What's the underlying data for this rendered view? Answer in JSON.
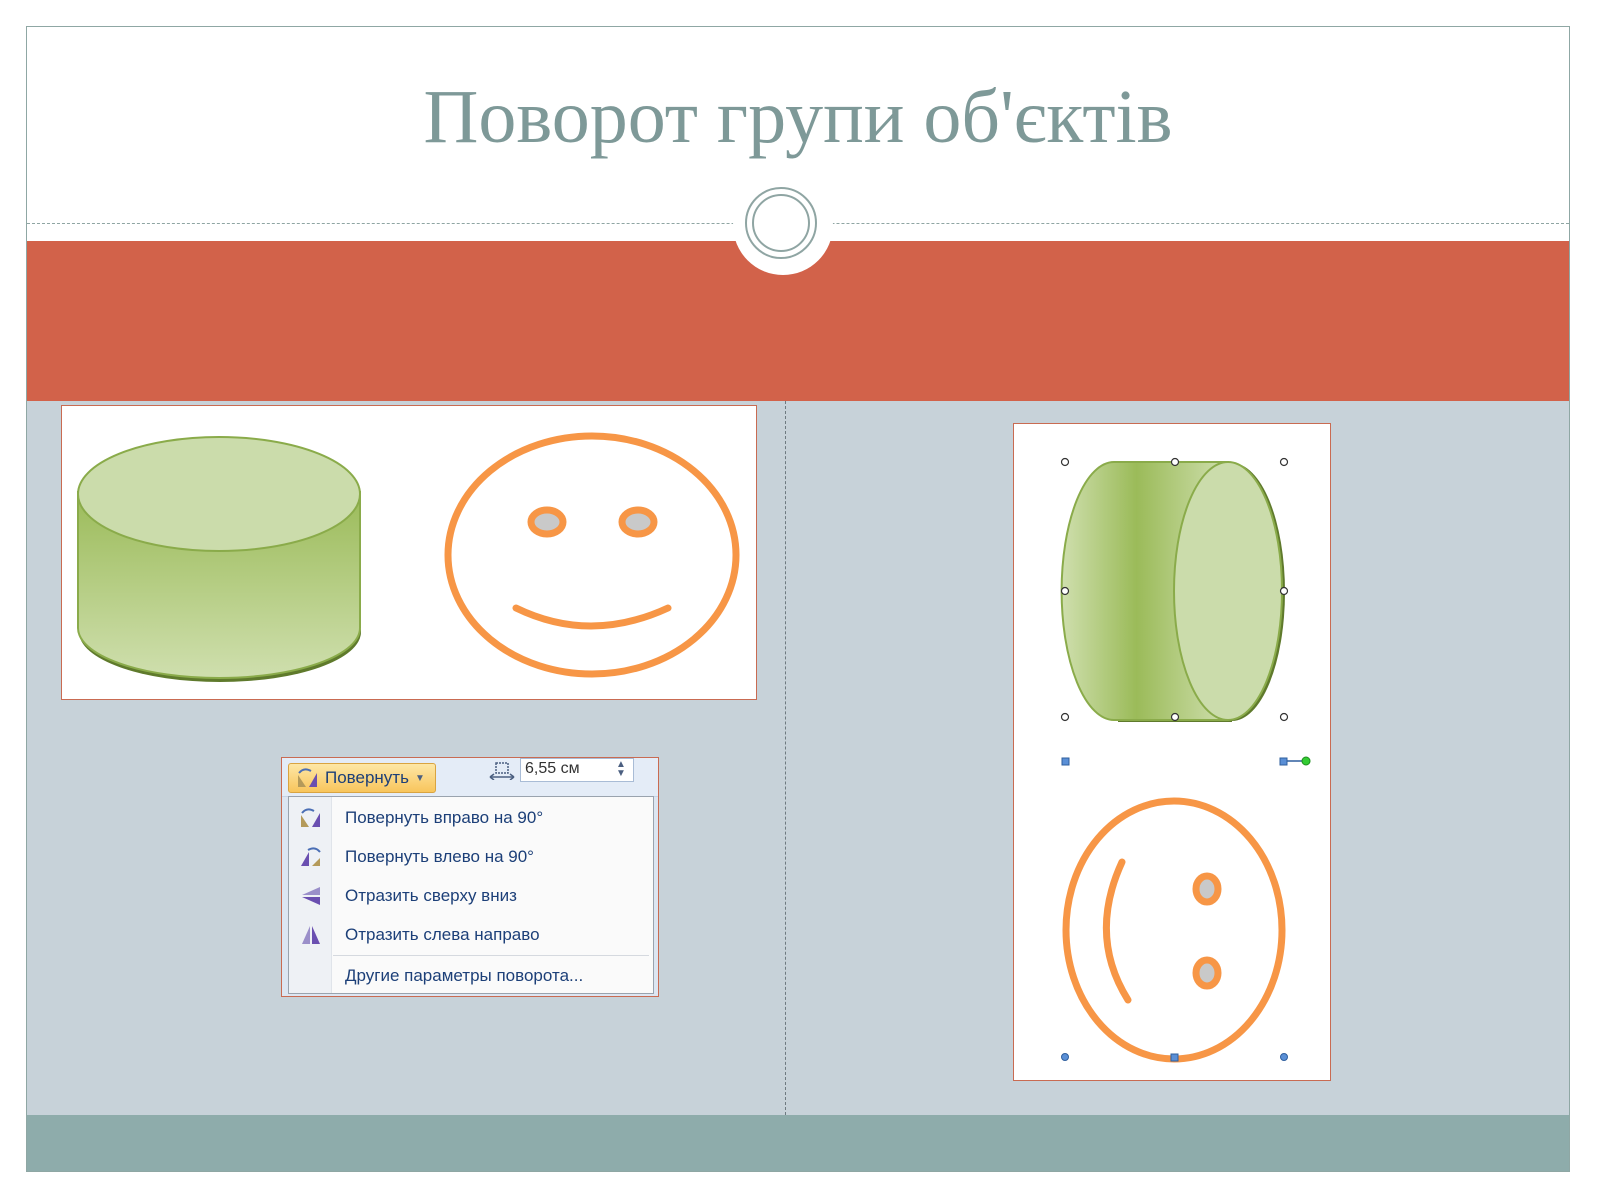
{
  "slide": {
    "title": "Поворот групи об'єктів"
  },
  "colors": {
    "title": "#7e9998",
    "red_band": "#d2624a",
    "content_bg": "#c7d2d9",
    "footer": "#8eacab",
    "cylinder_green": "#9bbb59",
    "smiley_orange": "#f79646",
    "menu_text": "#1c3f78"
  },
  "rotate_menu": {
    "button_label": "Повернуть",
    "size_value": "6,55 см",
    "items": [
      {
        "label": "Повернуть вправо на 90°",
        "icon": "rotate-right-icon"
      },
      {
        "label": "Повернуть влево на 90°",
        "icon": "rotate-left-icon"
      },
      {
        "label": "Отразить сверху вниз",
        "icon": "flip-vertical-icon"
      },
      {
        "label": "Отразить слева направо",
        "icon": "flip-horizontal-icon"
      },
      {
        "label": "Другие параметры поворота...",
        "icon": ""
      }
    ]
  }
}
